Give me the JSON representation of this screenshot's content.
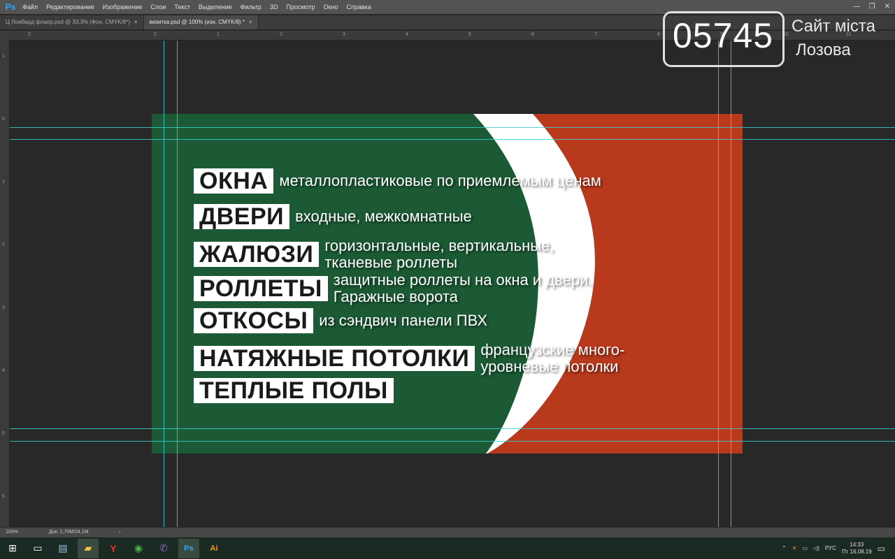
{
  "app": {
    "logo": "Ps",
    "menu": [
      "Файл",
      "Редактирование",
      "Изображение",
      "Слои",
      "Текст",
      "Выделение",
      "Фильтр",
      "3D",
      "Просмотр",
      "Окно",
      "Справка"
    ],
    "window_controls": [
      "—",
      "❐",
      "✕"
    ]
  },
  "tabs": [
    {
      "label": "Ц Ломбард флаер.psd @ 33,3% (Фон, CMYK/8*)",
      "close": "×",
      "active": false
    },
    {
      "label": "визитка.psd @ 100% (изн, CMYK/8) *",
      "close": "×",
      "active": true
    }
  ],
  "ruler": {
    "top": [
      "0",
      "1",
      "2",
      "3",
      "4",
      "5",
      "6",
      "7",
      "8",
      "9",
      "10",
      "11"
    ],
    "left": [
      "1",
      "0",
      "1",
      "2",
      "3",
      "4",
      "5",
      "6"
    ]
  },
  "card": {
    "colors": {
      "green": "#1b5a34",
      "red": "#b8391c",
      "white": "#ffffff"
    },
    "rows": [
      {
        "label": "ОКНА",
        "desc": [
          "металлопластиковые по приемлемым ценам"
        ]
      },
      {
        "label": "ДВЕРИ",
        "desc": [
          "входные, межкомнатные"
        ]
      },
      {
        "label": "ЖАЛЮЗИ",
        "desc": [
          "горизонтальные, вертикальные,",
          "тканевые роллеты"
        ]
      },
      {
        "label": "РОЛЛЕТЫ",
        "desc": [
          "защитные роллеты на окна и двери.",
          "Гаражные ворота"
        ]
      },
      {
        "label": "ОТКОСЫ",
        "desc": [
          "из сэндвич панели ПВХ"
        ]
      },
      {
        "label": "НАТЯЖНЫЕ ПОТОЛКИ",
        "desc": [
          "французские много-",
          "уровневые потолки"
        ]
      },
      {
        "label": "ТЕПЛЫЕ ПОЛЫ",
        "desc": []
      }
    ]
  },
  "status": {
    "zoom": "100%",
    "doc": "Док: 2,70M/24,1M",
    "arrow": "›"
  },
  "watermark": {
    "number": "05745",
    "line1": "Сайт міста",
    "line2": "Лозова"
  },
  "taskbar": {
    "icons": [
      "windows-start-icon",
      "task-view-icon",
      "notepad-icon",
      "file-explorer-icon",
      "yandex-browser-icon",
      "chrome-icon",
      "viber-icon",
      "photoshop-icon",
      "illustrator-icon"
    ],
    "glyphs": [
      "⊞",
      "▭",
      "▤",
      "▰",
      "Y",
      "◉",
      "✆",
      "Ps",
      "Ai"
    ],
    "lang": "РУС",
    "time": "14:33",
    "date": "Пт 16.08.19"
  }
}
